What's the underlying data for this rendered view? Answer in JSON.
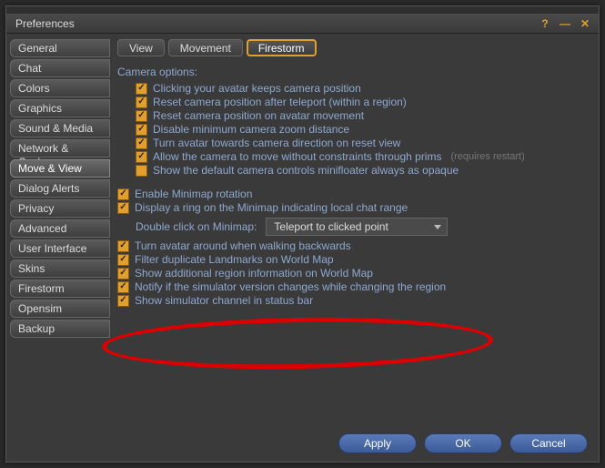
{
  "window": {
    "title": "Preferences"
  },
  "titlebar_icons": {
    "help": "?",
    "minimize": "—",
    "close": "✕"
  },
  "sidebar": {
    "items": [
      {
        "label": "General"
      },
      {
        "label": "Chat"
      },
      {
        "label": "Colors"
      },
      {
        "label": "Graphics"
      },
      {
        "label": "Sound & Media"
      },
      {
        "label": "Network & Cache"
      },
      {
        "label": "Move & View"
      },
      {
        "label": "Dialog Alerts"
      },
      {
        "label": "Privacy"
      },
      {
        "label": "Advanced"
      },
      {
        "label": "User Interface"
      },
      {
        "label": "Skins"
      },
      {
        "label": "Firestorm"
      },
      {
        "label": "Opensim"
      },
      {
        "label": "Backup"
      }
    ],
    "active_index": 6
  },
  "tabs": {
    "items": [
      {
        "label": "View"
      },
      {
        "label": "Movement"
      },
      {
        "label": "Firestorm"
      }
    ],
    "active_index": 2
  },
  "camera": {
    "heading": "Camera options:",
    "opts": [
      {
        "label": "Clicking your avatar keeps camera position",
        "checked": true
      },
      {
        "label": "Reset camera position after teleport (within a region)",
        "checked": true
      },
      {
        "label": "Reset camera position on avatar movement",
        "checked": true
      },
      {
        "label": "Disable minimum camera zoom distance",
        "checked": true
      },
      {
        "label": "Turn avatar towards camera direction on reset view",
        "checked": true
      },
      {
        "label": "Allow the camera to move without constraints through prims",
        "checked": true,
        "hint": "(requires restart)"
      },
      {
        "label": "Show the default camera controls minifloater always as opaque",
        "checked": false
      }
    ]
  },
  "minimap": {
    "opts_top": [
      {
        "label": "Enable Minimap rotation",
        "checked": true
      },
      {
        "label": "Display a ring on the Minimap indicating local chat range",
        "checked": true
      }
    ],
    "double_click_label": "Double click on Minimap:",
    "double_click_value": "Teleport to clicked point",
    "opts_bottom": [
      {
        "label": "Turn avatar around when walking backwards",
        "checked": true
      },
      {
        "label": "Filter duplicate Landmarks on World Map",
        "checked": true
      },
      {
        "label": "Show additional region information on World Map",
        "checked": true
      },
      {
        "label": "Notify if the simulator version changes while changing the region",
        "checked": true
      },
      {
        "label": "Show simulator channel in status bar",
        "checked": true
      }
    ]
  },
  "buttons": {
    "apply": "Apply",
    "ok": "OK",
    "cancel": "Cancel"
  },
  "colors": {
    "accent": "#e0a030",
    "link": "#8fa8d0",
    "highlight": "#d00"
  }
}
